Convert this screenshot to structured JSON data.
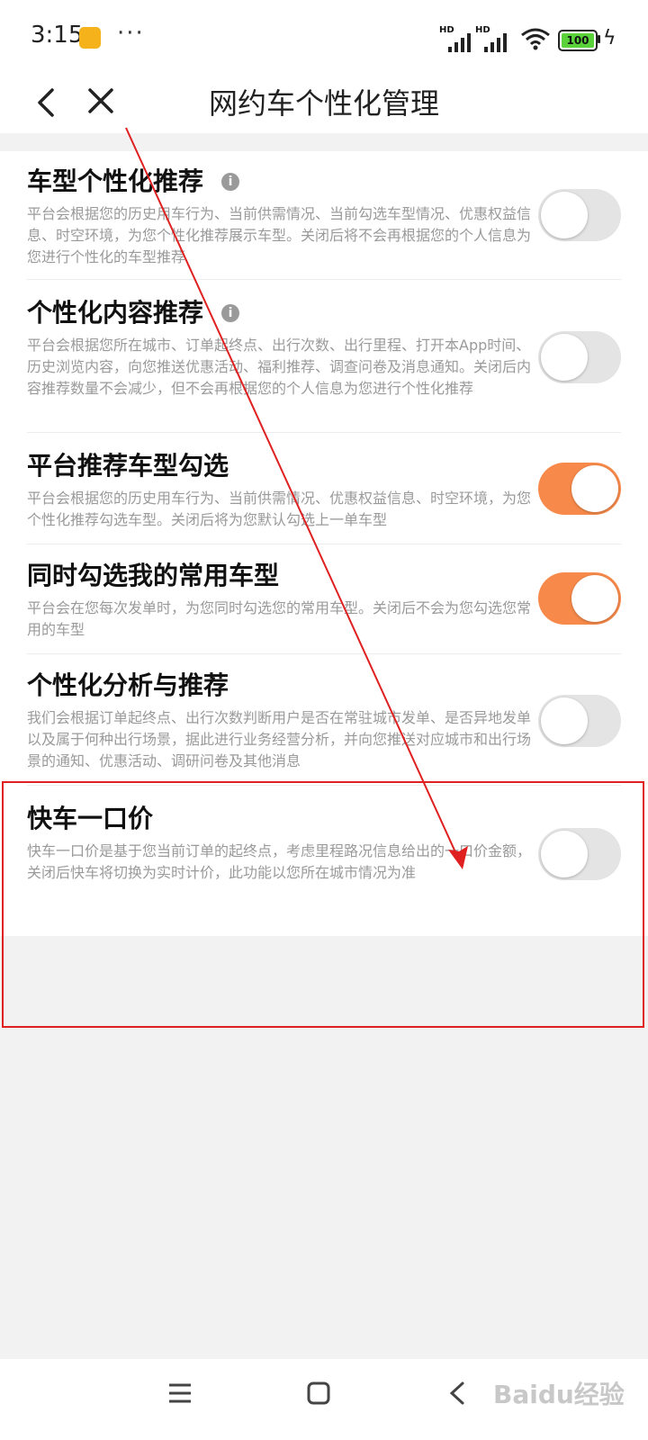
{
  "status_bar": {
    "time": "3:15",
    "more": "···",
    "network_label_1": "HD",
    "network_label_2": "HD",
    "battery": "100"
  },
  "header": {
    "title": "网约车个性化管理"
  },
  "settings": [
    {
      "title": "车型个性化推荐",
      "has_info": true,
      "description": "平台会根据您的历史用车行为、当前供需情况、当前勾选车型情况、优惠权益信息、时空环境，为您个性化推荐展示车型。关闭后将不会再根据您的个人信息为您进行个性化的车型推荐",
      "enabled": false
    },
    {
      "title": "个性化内容推荐",
      "has_info": true,
      "description": "平台会根据您所在城市、订单起终点、出行次数、出行里程、打开本App时间、历史浏览内容，向您推送优惠活动、福利推荐、调查问卷及消息通知。关闭后内容推荐数量不会减少，但不会再根据您的个人信息为您进行个性化推荐",
      "enabled": false
    },
    {
      "title": "平台推荐车型勾选",
      "has_info": false,
      "description": "平台会根据您的历史用车行为、当前供需情况、优惠权益信息、时空环境，为您个性化推荐勾选车型。关闭后将为您默认勾选上一单车型",
      "enabled": true
    },
    {
      "title": "同时勾选我的常用车型",
      "has_info": false,
      "description": "平台会在您每次发单时，为您同时勾选您的常用车型。关闭后不会为您勾选您常用的车型",
      "enabled": true
    },
    {
      "title": "个性化分析与推荐",
      "has_info": false,
      "description": "我们会根据订单起终点、出行次数判断用户是否在常驻城市发单、是否异地发单以及属于何种出行场景，据此进行业务经营分析，并向您推送对应城市和出行场景的通知、优惠活动、调研问卷及其他消息",
      "enabled": false
    },
    {
      "title": "快车一口价",
      "has_info": false,
      "description": "快车一口价是基于您当前订单的起终点，考虑里程路况信息给出的一口价金额，关闭后快车将切换为实时计价，此功能以您所在城市情况为准",
      "enabled": false
    }
  ],
  "watermark": "Baidu经验",
  "colors": {
    "toggle_on": "#f78a4a",
    "toggle_off": "#e4e4e4",
    "annotation": "#e02020"
  }
}
